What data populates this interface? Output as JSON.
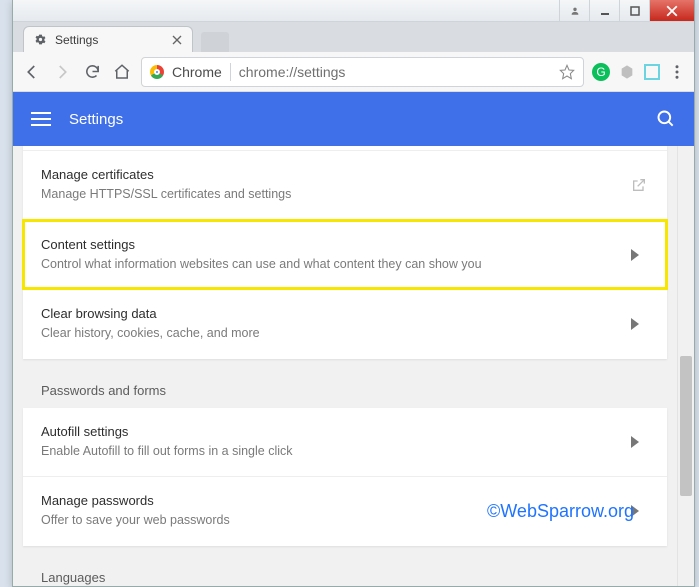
{
  "os": {
    "user_icon": "user-icon"
  },
  "tab": {
    "title": "Settings"
  },
  "toolbar": {
    "secure_label": "Chrome",
    "url": "chrome://settings"
  },
  "header": {
    "title": "Settings"
  },
  "sections": {
    "privacy": {
      "rows": [
        {
          "title": "Manage certificates",
          "desc": "Manage HTTPS/SSL certificates and settings",
          "icon": "external"
        },
        {
          "title": "Content settings",
          "desc": "Control what information websites can use and what content they can show you",
          "icon": "chevron",
          "highlight": true
        },
        {
          "title": "Clear browsing data",
          "desc": "Clear history, cookies, cache, and more",
          "icon": "chevron"
        }
      ]
    },
    "passwords": {
      "label": "Passwords and forms",
      "rows": [
        {
          "title": "Autofill settings",
          "desc": "Enable Autofill to fill out forms in a single click",
          "icon": "chevron"
        },
        {
          "title": "Manage passwords",
          "desc": "Offer to save your web passwords",
          "icon": "chevron"
        }
      ]
    },
    "languages": {
      "label": "Languages"
    }
  },
  "watermark": "©WebSparrow.org"
}
